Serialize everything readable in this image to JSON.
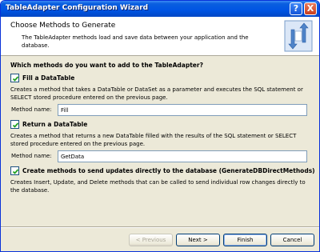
{
  "window": {
    "title": "TableAdapter Configuration Wizard"
  },
  "titlebar": {
    "help_glyph": "?",
    "close_glyph": "X",
    "help_icon": "help-icon",
    "close_icon": "close-icon"
  },
  "header": {
    "title": "Choose Methods to Generate",
    "description": "The TableAdapter methods load and save data between your application and the database.",
    "icon": "wizard-icon"
  },
  "content": {
    "question": "Which methods do you want to add to the TableAdapter?",
    "fill": {
      "checkbox_label": "Fill a DataTable",
      "checked": true,
      "description": "Creates a method that takes a DataTable or DataSet as a parameter and executes the SQL statement or SELECT stored procedure entered on the previous page.",
      "method_label": "Method name:",
      "method_value": "Fill"
    },
    "return": {
      "checkbox_label": "Return a DataTable",
      "checked": true,
      "description": "Creates a method that returns a new DataTable filled with the results of the SQL statement or SELECT stored procedure entered on the previous page.",
      "method_label": "Method name:",
      "method_value": "GetData"
    },
    "direct": {
      "checkbox_label": "Create methods to send updates directly to the database (GenerateDBDirectMethods)",
      "checked": true,
      "description": "Creates Insert, Update, and Delete methods that can be called to send individual row changes directly to the database."
    }
  },
  "footer": {
    "previous_label": "< Previous",
    "next_label": "Next >",
    "finish_label": "Finish",
    "cancel_label": "Cancel"
  },
  "colors": {
    "titlebar": "#0054e3",
    "dialog_bg": "#ece9d8",
    "header_bg": "#ffffff",
    "check": "#21a121"
  }
}
